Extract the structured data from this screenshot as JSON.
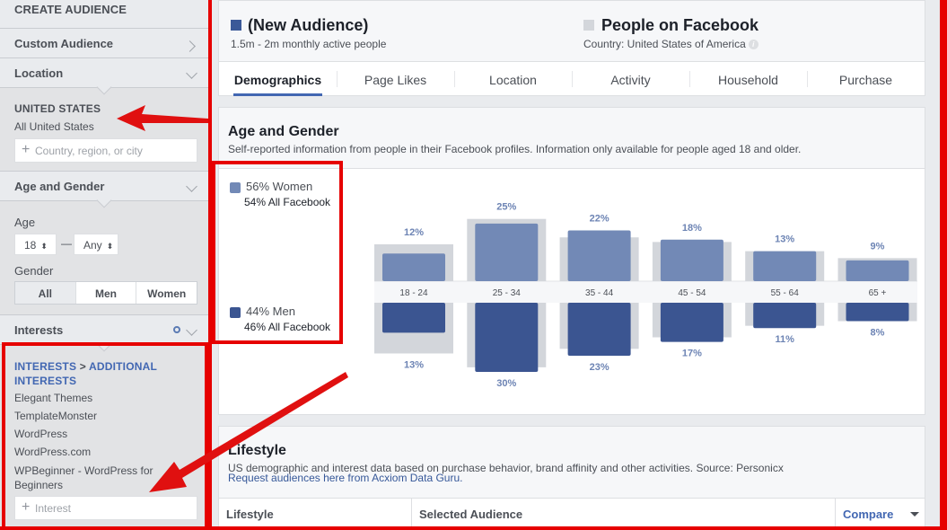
{
  "sidebar": {
    "title": "CREATE AUDIENCE",
    "custom_audience": "Custom Audience",
    "location": {
      "label": "Location",
      "country": "UNITED STATES",
      "scope": "All United States",
      "input_placeholder": "Country, region, or city"
    },
    "age_gender": {
      "label": "Age and Gender",
      "age_label": "Age",
      "age_min": "18",
      "age_sep": "—",
      "age_max": "Any",
      "gender_label": "Gender",
      "gender_options": [
        "All",
        "Men",
        "Women"
      ],
      "gender_selected": "All"
    },
    "interests": {
      "label": "Interests",
      "breadcrumb_root": "INTERESTS",
      "breadcrumb_sep": " > ",
      "breadcrumb_leaf": "ADDITIONAL INTERESTS",
      "items": [
        "Elegant Themes",
        "TemplateMonster",
        "WordPress",
        "WordPress.com",
        "WPBeginner - WordPress for Beginners"
      ],
      "input_placeholder": "Interest"
    }
  },
  "header": {
    "audience_title": "(New Audience)",
    "audience_sub": "1.5m - 2m monthly active people",
    "audience_color": "#3b5998",
    "compare_title": "People on Facebook",
    "compare_sub": "Country: United States of America",
    "compare_color": "#d3d6db",
    "tabs": [
      "Demographics",
      "Page Likes",
      "Location",
      "Activity",
      "Household",
      "Purchase"
    ],
    "active_tab": "Demographics"
  },
  "age_gender": {
    "title": "Age and Gender",
    "subtitle": "Self-reported information from people in their Facebook profiles. Information only available for people aged 18 and older.",
    "legend": {
      "women": {
        "label": "56% Women",
        "sub": "54% All Facebook",
        "color": "#7289b6"
      },
      "men": {
        "label": "44% Men",
        "sub": "46% All Facebook",
        "color": "#3b5591"
      }
    }
  },
  "chart_data": {
    "type": "bar",
    "title": "Age and Gender",
    "categories": [
      "18 - 24",
      "25 - 34",
      "35 - 44",
      "45 - 54",
      "55 - 64",
      "65 +"
    ],
    "series": [
      {
        "name": "Women (Selected Audience)",
        "values": [
          12,
          25,
          22,
          18,
          13,
          9
        ],
        "unit": "%",
        "direction": "up",
        "color": "#7289b6"
      },
      {
        "name": "Men (Selected Audience)",
        "values": [
          13,
          30,
          23,
          17,
          11,
          8
        ],
        "unit": "%",
        "direction": "down",
        "color": "#3b5591"
      },
      {
        "name": "Women (All Facebook)",
        "values": [
          16,
          27,
          19,
          17,
          13,
          10
        ],
        "unit": "%",
        "direction": "up",
        "color": "#d3d6db"
      },
      {
        "name": "Men (All Facebook)",
        "values": [
          22,
          28,
          20,
          15,
          10,
          8
        ],
        "unit": "%",
        "direction": "down",
        "color": "#d3d6db"
      }
    ],
    "xlabel": "",
    "ylabel": "",
    "ylim": [
      0,
      30
    ]
  },
  "lifestyle": {
    "title": "Lifestyle",
    "subtitle": "US demographic and interest data based on purchase behavior, brand affinity and other activities. Source: Personicx",
    "link": "Request audiences here from Acxiom Data Guru.",
    "columns": [
      "Lifestyle",
      "Selected Audience"
    ],
    "compare_label": "Compare"
  }
}
